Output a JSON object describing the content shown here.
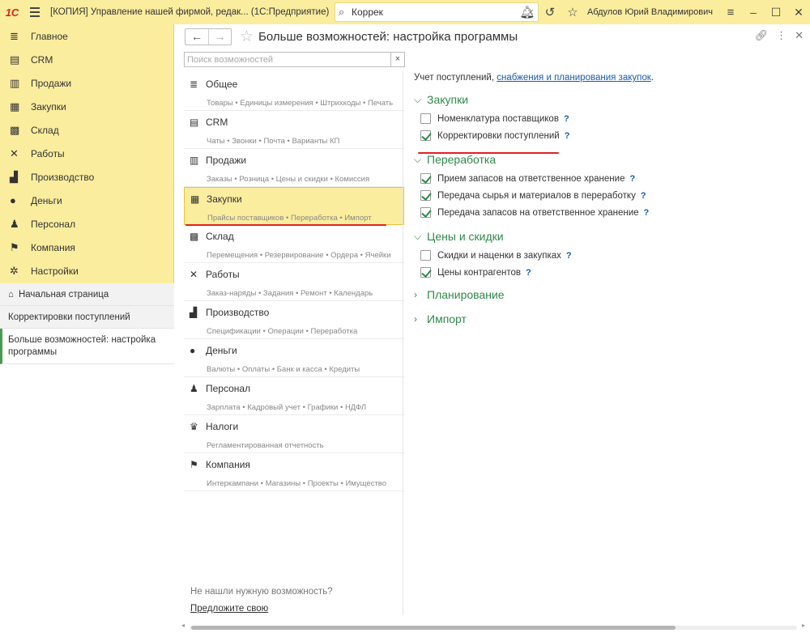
{
  "titlebar": {
    "logo": "1С",
    "title": "[КОПИЯ] Управление нашей фирмой, редак...  (1С:Предприятие)",
    "search_value": "Коррек",
    "user": "Абдулов Юрий Владимирович"
  },
  "sidebar": {
    "items": [
      {
        "label": "Главное",
        "icon": "≣"
      },
      {
        "label": "CRM",
        "icon": "▤"
      },
      {
        "label": "Продажи",
        "icon": "▥"
      },
      {
        "label": "Закупки",
        "icon": "▦"
      },
      {
        "label": "Склад",
        "icon": "▩"
      },
      {
        "label": "Работы",
        "icon": "✕"
      },
      {
        "label": "Производство",
        "icon": "▟"
      },
      {
        "label": "Деньги",
        "icon": "●"
      },
      {
        "label": "Персонал",
        "icon": "♟"
      },
      {
        "label": "Компания",
        "icon": "⚑"
      },
      {
        "label": "Настройки",
        "icon": "✲"
      }
    ],
    "open": {
      "home": "Начальная страница",
      "tab1": "Корректировки поступлений",
      "active": "Больше возможностей: настройка программы"
    }
  },
  "main": {
    "title": "Больше возможностей: настройка программы",
    "search_placeholder": "Поиск возможностей",
    "categories": [
      {
        "title": "Общее",
        "icon": "≣",
        "sub": "Товары • Единицы измерения • Штрихкоды • Печать",
        "selected": false
      },
      {
        "title": "CRM",
        "icon": "▤",
        "sub": "Чаты • Звонки • Почта • Варианты КП",
        "selected": false
      },
      {
        "title": "Продажи",
        "icon": "▥",
        "sub": "Заказы • Розница • Цены и скидки • Комиссия",
        "selected": false
      },
      {
        "title": "Закупки",
        "icon": "▦",
        "sub": "Прайсы поставщиков • Переработка • Импорт",
        "selected": true
      },
      {
        "title": "Склад",
        "icon": "▩",
        "sub": "Перемещения • Резервирование • Ордера • Ячейки",
        "selected": false
      },
      {
        "title": "Работы",
        "icon": "✕",
        "sub": "Заказ-наряды • Задания • Ремонт • Календарь",
        "selected": false
      },
      {
        "title": "Производство",
        "icon": "▟",
        "sub": "Спецификации • Операции • Переработка",
        "selected": false
      },
      {
        "title": "Деньги",
        "icon": "●",
        "sub": "Валюты • Оплаты • Банк и касса • Кредиты",
        "selected": false
      },
      {
        "title": "Персонал",
        "icon": "♟",
        "sub": "Зарплата • Кадровый учет • Графики • НДФЛ",
        "selected": false
      },
      {
        "title": "Налоги",
        "icon": "♛",
        "sub": "Регламентированная отчетность",
        "selected": false
      },
      {
        "title": "Компания",
        "icon": "⚑",
        "sub": "Интеркампани • Магазины • Проекты • Имущество",
        "selected": false
      }
    ],
    "bottom_note": "Не нашли нужную возможность?",
    "bottom_link": "Предложите свою"
  },
  "settings": {
    "intro_text": "Учет поступлений, ",
    "intro_link": "снабжения и планирования закупок",
    "intro_end": ".",
    "groups": [
      {
        "title": "Закупки",
        "expanded": true,
        "options": [
          {
            "label": "Номенклатура поставщиков",
            "checked": false
          },
          {
            "label": "Корректировки поступлений",
            "checked": true
          }
        ]
      },
      {
        "title": "Переработка",
        "expanded": true,
        "options": [
          {
            "label": "Прием запасов на ответственное хранение",
            "checked": true
          },
          {
            "label": "Передача сырья и материалов в переработку",
            "checked": true
          },
          {
            "label": "Передача запасов на ответственное хранение",
            "checked": true
          }
        ]
      },
      {
        "title": "Цены и скидки",
        "expanded": true,
        "options": [
          {
            "label": "Скидки и наценки в закупках",
            "checked": false
          },
          {
            "label": "Цены контрагентов",
            "checked": true
          }
        ]
      },
      {
        "title": "Планирование",
        "expanded": false,
        "options": []
      },
      {
        "title": "Импорт",
        "expanded": false,
        "options": []
      }
    ],
    "help": "?"
  },
  "colors": {
    "accent_yellow": "#fbed9e",
    "green": "#2f8a49",
    "link": "#1a5ca8",
    "red_mark": "#e02020"
  }
}
